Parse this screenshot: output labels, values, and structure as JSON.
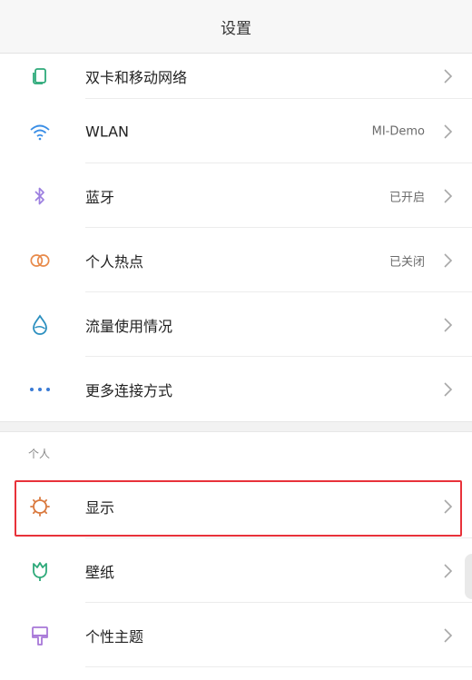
{
  "header": {
    "title": "设置"
  },
  "network_items": [
    {
      "label": "双卡和移动网络",
      "value": "",
      "icon": "sim-cards-icon"
    },
    {
      "label": "WLAN",
      "value": "MI-Demo",
      "icon": "wifi-icon"
    },
    {
      "label": "蓝牙",
      "value": "已开启",
      "icon": "bluetooth-icon"
    },
    {
      "label": "个人热点",
      "value": "已关闭",
      "icon": "hotspot-icon"
    },
    {
      "label": "流量使用情况",
      "value": "",
      "icon": "data-usage-icon"
    },
    {
      "label": "更多连接方式",
      "value": "",
      "icon": "more-dots-icon"
    }
  ],
  "personal_section": {
    "title": "个人",
    "items": [
      {
        "label": "显示",
        "icon": "brightness-icon"
      },
      {
        "label": "壁纸",
        "icon": "wallpaper-tulip-icon"
      },
      {
        "label": "个性主题",
        "icon": "theme-brush-icon"
      }
    ]
  },
  "colors": {
    "highlight_border": "#e8323a",
    "sim_icon": "#2eaa7a",
    "wifi_icon": "#3a8ee6",
    "bluetooth_icon": "#9c7fe0",
    "hotspot_icon": "#e88a4a",
    "data_icon": "#2b8fbf",
    "more_icon": "#3a7bd5",
    "display_icon": "#d9773b",
    "wallpaper_icon": "#2eaa7a",
    "theme_icon": "#a878d8"
  }
}
